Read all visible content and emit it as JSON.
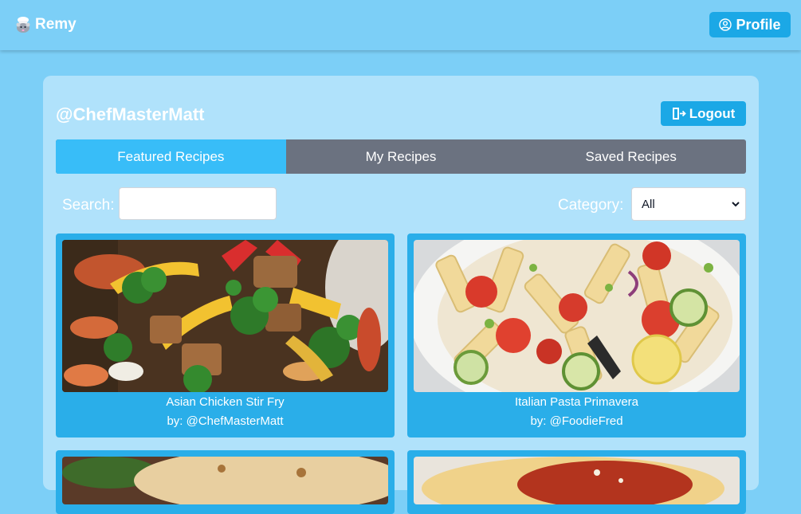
{
  "navbar": {
    "brand": "Remy",
    "profile_label": "Profile"
  },
  "account": {
    "username": "@ChefMasterMatt",
    "logout_label": "Logout"
  },
  "tabs": [
    {
      "label": "Featured Recipes",
      "active": true
    },
    {
      "label": "My Recipes",
      "active": false
    },
    {
      "label": "Saved Recipes",
      "active": false
    }
  ],
  "filters": {
    "search_label": "Search:",
    "search_value": "",
    "category_label": "Category:",
    "category_selected": "All"
  },
  "recipes": [
    {
      "title": "Asian Chicken Stir Fry",
      "author": "by: @ChefMasterMatt",
      "image": "stir-fry-photo"
    },
    {
      "title": "Italian Pasta Primavera",
      "author": "by: @FoodieFred",
      "image": "pasta-primavera-photo"
    },
    {
      "title": "",
      "author": "",
      "image": "tortilla-photo"
    },
    {
      "title": "",
      "author": "",
      "image": "pasta-sauce-photo"
    }
  ],
  "colors": {
    "background": "#7ccff7",
    "panel": "#b0e2fb",
    "accent": "#1ba8e6",
    "tab_active": "#38bdf8",
    "tab_inactive": "#6b7280",
    "card": "#2aaee9"
  }
}
